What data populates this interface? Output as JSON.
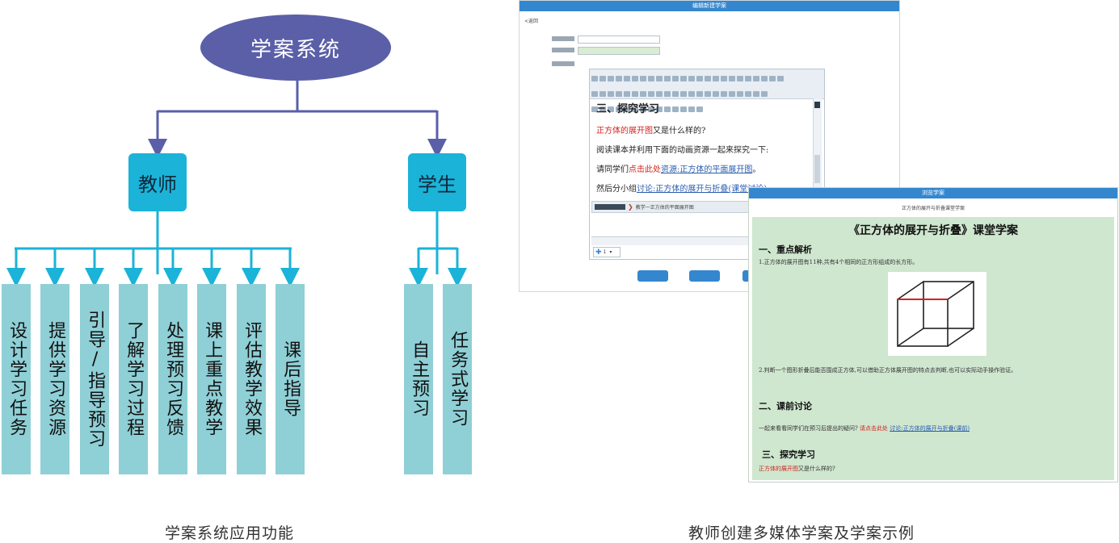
{
  "diagram": {
    "root": "学案系统",
    "teacher": "教师",
    "student": "学生",
    "teacher_items": [
      "设计学习任务",
      "提供学习资源",
      "引导/指导预习",
      "了解学习过程",
      "处理预习反馈",
      "课上重点教学",
      "评估教学效果",
      "课后指导"
    ],
    "student_items": [
      "自主预习",
      "任务式学习"
    ],
    "caption": "学案系统应用功能",
    "colors": {
      "root": "#5a5fa8",
      "role": "#1bb3d8",
      "leaf": "#8fcfd6",
      "connector": "#5a5fa8",
      "connector_leaf": "#1bb3d8"
    }
  },
  "editor_window": {
    "title": "编辑新建学案",
    "back_label": "<返回",
    "editor_lines": [
      {
        "segments": [
          {
            "text": "三、探究学习",
            "style": "heading"
          }
        ]
      },
      {
        "segments": [
          {
            "text": "正方体的展开图",
            "style": "red"
          },
          {
            "text": "又是什么样的?",
            "style": "plain"
          }
        ]
      },
      {
        "segments": [
          {
            "text": "阅读课本并利用下面的动画资源一起来探究一下:",
            "style": "plain"
          }
        ]
      },
      {
        "segments": [
          {
            "text": "请同学们",
            "style": "plain"
          },
          {
            "text": "点击此处",
            "style": "red"
          },
          {
            "text": "资源:正方体的平面展开图",
            "style": "link"
          },
          {
            "text": "。",
            "style": "plain"
          }
        ]
      },
      {
        "segments": [
          {
            "text": "然后分小组",
            "style": "plain"
          },
          {
            "text": "讨论:正方体的展开与折叠(课堂讨论)",
            "style": "link"
          }
        ]
      }
    ],
    "breadcrumb_text": "教学一正方体的平面展开图",
    "page_select_value": "1",
    "colors": {
      "titlebar": "#3487cf",
      "buttons": "#3487cf"
    }
  },
  "sample_window": {
    "title": "浏览学案",
    "subtitle": "正方体的展开与折叠课堂学案",
    "heading": "《正方体的展开与折叠》课堂学案",
    "sections": [
      {
        "title": "一、重点解析",
        "text": "1.正方体的展开图有11种,共有4个相同的正方形组成的长方形。"
      },
      {
        "title": "二、课前讨论",
        "text": "一起来看看同学们在预习后提出的疑问?",
        "red": "请点击此处",
        "link": "讨论:正方体的展开与折叠(课前)"
      },
      {
        "title": "三、探究学习",
        "red": "正方体的展开图",
        "text": "又是什么样的?"
      }
    ],
    "after_image_text": "2.判断一个图形折叠后能否围成正方体,可以借助正方体展开图的特点去判断,也可以实际动手操作验证。",
    "colors": {
      "background": "#cfe6cf",
      "cube_edge_highlight": "#d2231c"
    }
  },
  "right_caption": "教师创建多媒体学案及学案示例"
}
